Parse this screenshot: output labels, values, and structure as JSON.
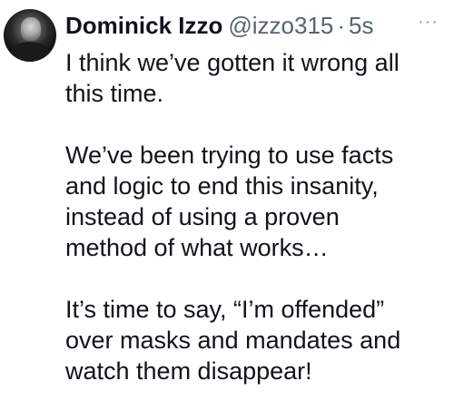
{
  "tweet": {
    "author_name": "Dominick Izzo",
    "handle": "@izzo315",
    "separator": "·",
    "timestamp": "5s",
    "more_menu": "···",
    "paragraphs": [
      "I think we’ve gotten it wrong all\nthis time.",
      "We’ve been trying to use facts\nand logic to end this insanity,\ninstead of using a proven\nmethod of what works…",
      "It’s time to say, “I’m offended”\nover masks and mandates and\nwatch them disappear!"
    ]
  },
  "colors": {
    "text_primary": "#0f1419",
    "text_secondary": "#536471",
    "background": "#ffffff"
  }
}
